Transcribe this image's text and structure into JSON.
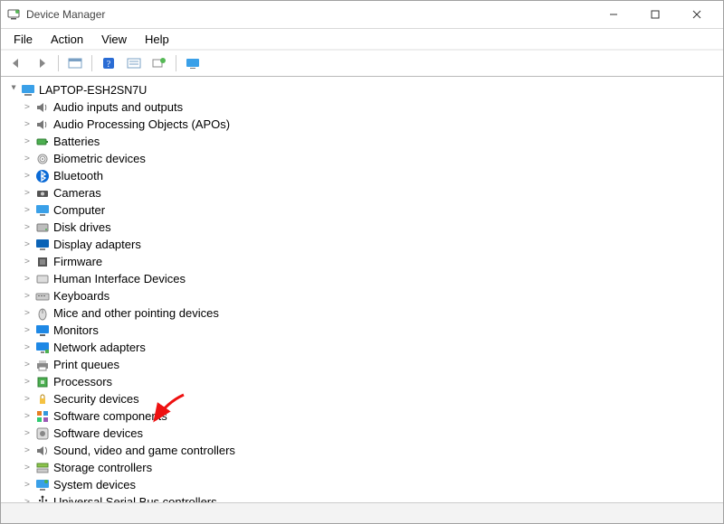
{
  "window": {
    "title": "Device Manager"
  },
  "menubar": {
    "items": [
      "File",
      "Action",
      "View",
      "Help"
    ]
  },
  "toolbar": {
    "buttons": [
      {
        "name": "back-button",
        "icon": "arrow-left"
      },
      {
        "name": "forward-button",
        "icon": "arrow-right"
      },
      {
        "name": "show-hidden-button",
        "icon": "show-hidden"
      },
      {
        "name": "help-button",
        "icon": "help"
      },
      {
        "name": "properties-button",
        "icon": "properties"
      },
      {
        "name": "scan-hardware-button",
        "icon": "scan"
      },
      {
        "name": "add-legacy-button",
        "icon": "monitor"
      }
    ]
  },
  "tree": {
    "root": {
      "name": "LAPTOP-ESH2SN7U"
    },
    "categories": [
      {
        "label": "Audio inputs and outputs",
        "icon": "speaker"
      },
      {
        "label": "Audio Processing Objects (APOs)",
        "icon": "speaker"
      },
      {
        "label": "Batteries",
        "icon": "battery"
      },
      {
        "label": "Biometric devices",
        "icon": "fingerprint"
      },
      {
        "label": "Bluetooth",
        "icon": "bluetooth"
      },
      {
        "label": "Cameras",
        "icon": "camera"
      },
      {
        "label": "Computer",
        "icon": "monitor"
      },
      {
        "label": "Disk drives",
        "icon": "disk"
      },
      {
        "label": "Display adapters",
        "icon": "display"
      },
      {
        "label": "Firmware",
        "icon": "chip"
      },
      {
        "label": "Human Interface Devices",
        "icon": "hid"
      },
      {
        "label": "Keyboards",
        "icon": "keyboard"
      },
      {
        "label": "Mice and other pointing devices",
        "icon": "mouse"
      },
      {
        "label": "Monitors",
        "icon": "monitor-blue"
      },
      {
        "label": "Network adapters",
        "icon": "network"
      },
      {
        "label": "Print queues",
        "icon": "printer"
      },
      {
        "label": "Processors",
        "icon": "cpu"
      },
      {
        "label": "Security devices",
        "icon": "security"
      },
      {
        "label": "Software components",
        "icon": "components"
      },
      {
        "label": "Software devices",
        "icon": "software"
      },
      {
        "label": "Sound, video and game controllers",
        "icon": "sound"
      },
      {
        "label": "Storage controllers",
        "icon": "storage"
      },
      {
        "label": "System devices",
        "icon": "system"
      },
      {
        "label": "Universal Serial Bus controllers",
        "icon": "usb"
      }
    ]
  },
  "annotation": {
    "arrow_target_index": 14
  }
}
